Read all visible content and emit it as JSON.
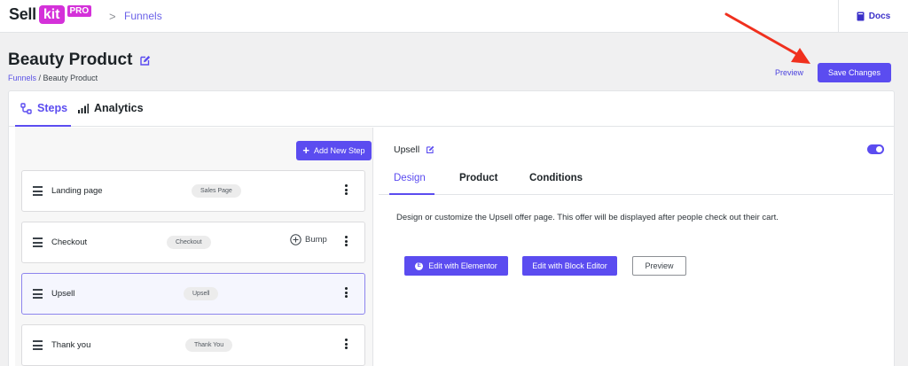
{
  "brand": {
    "sell": "Sell",
    "kit": "kit",
    "pro": "PRO"
  },
  "topnav": {
    "separator": ">",
    "funnels_link": "Funnels",
    "docs": "Docs"
  },
  "page": {
    "title": "Beauty Product",
    "breadcrumb_link": "Funnels",
    "breadcrumb_sep": " / ",
    "breadcrumb_current": "Beauty Product"
  },
  "actions": {
    "preview": "Preview",
    "save": "Save Changes"
  },
  "tabs": {
    "steps": "Steps",
    "analytics": "Analytics"
  },
  "left": {
    "add_step": "Add New Step",
    "steps": [
      {
        "name": "Landing page",
        "badge": "Sales Page"
      },
      {
        "name": "Checkout",
        "badge": "Checkout",
        "extra": "Bump"
      },
      {
        "name": "Upsell",
        "badge": "Upsell",
        "active": true
      },
      {
        "name": "Thank you",
        "badge": "Thank You"
      }
    ]
  },
  "right": {
    "title": "Upsell",
    "toggle_on": true,
    "tabs": [
      "Design",
      "Product",
      "Conditions"
    ],
    "active_tab": "Design",
    "description": "Design or customize the Upsell offer page. This offer will be displayed after people check out their cart.",
    "buttons": {
      "elementor": "Edit with Elementor",
      "block_editor": "Edit with Block Editor",
      "preview": "Preview"
    }
  },
  "colors": {
    "accent": "#5b4cf0",
    "brand_pink": "#d431d9",
    "annotation_arrow": "#f0301e"
  },
  "icons": [
    "edit-icon",
    "book-icon",
    "steps-icon",
    "analytics-icon",
    "drag-handle-icon",
    "more-vertical-icon",
    "add-circle-icon",
    "elementor-icon"
  ]
}
